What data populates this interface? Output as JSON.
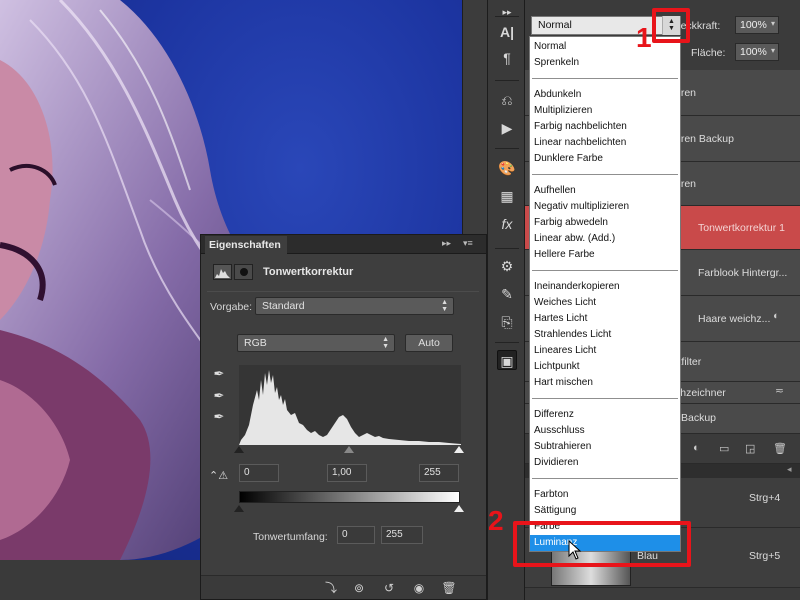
{
  "blend_mode": {
    "current": "Normal",
    "groups": [
      [
        "Normal",
        "Sprenkeln"
      ],
      [
        "Abdunkeln",
        "Multiplizieren",
        "Farbig nachbelichten",
        "Linear nachbelichten",
        "Dunklere Farbe"
      ],
      [
        "Aufhellen",
        "Negativ multiplizieren",
        "Farbig abwedeln",
        "Linear abw. (Add.)",
        "Hellere Farbe"
      ],
      [
        "Ineinanderkopieren",
        "Weiches Licht",
        "Hartes Licht",
        "Strahlendes Licht",
        "Lineares Licht",
        "Lichtpunkt",
        "Hart mischen"
      ],
      [
        "Differenz",
        "Ausschluss",
        "Subtrahieren",
        "Dividieren"
      ],
      [
        "Farbton",
        "Sättigung",
        "Farbe",
        "Luminanz"
      ]
    ],
    "selected": "Luminanz"
  },
  "opacity": {
    "label": "Deckkraft:",
    "value": "100%"
  },
  "fill": {
    "label": "Fläche:",
    "value": "100%"
  },
  "layers": {
    "row1_partial": "uren",
    "row2_partial": "uren Backup",
    "row3_partial": "uren",
    "row4": "Tonwertkorrektur 1",
    "row5": "Farblook Hintergr...",
    "row6": "Haare weichz...",
    "row7_partial": "rtfilter",
    "row8_partial": "chzeichner",
    "row9_partial": "Backup",
    "shortcut1": "Strg+4",
    "shortcut2": "Strg+5",
    "blau_label": "Blau"
  },
  "properties": {
    "tab": "Eigenschaften",
    "title": "Tonwertkorrektur",
    "preset_label": "Vorgabe:",
    "preset_value": "Standard",
    "channel": "RGB",
    "auto_label": "Auto",
    "input_black": "0",
    "input_gamma": "1,00",
    "input_white": "255",
    "output_label": "Tonwertumfang:",
    "output_black": "0",
    "output_white": "255"
  },
  "annotations": {
    "marker1": "1",
    "marker2": "2"
  },
  "colors": {
    "selection_blue": "#1e8fe8",
    "annotation_red": "#e8141a",
    "layer_highlight": "#c94a4a"
  }
}
